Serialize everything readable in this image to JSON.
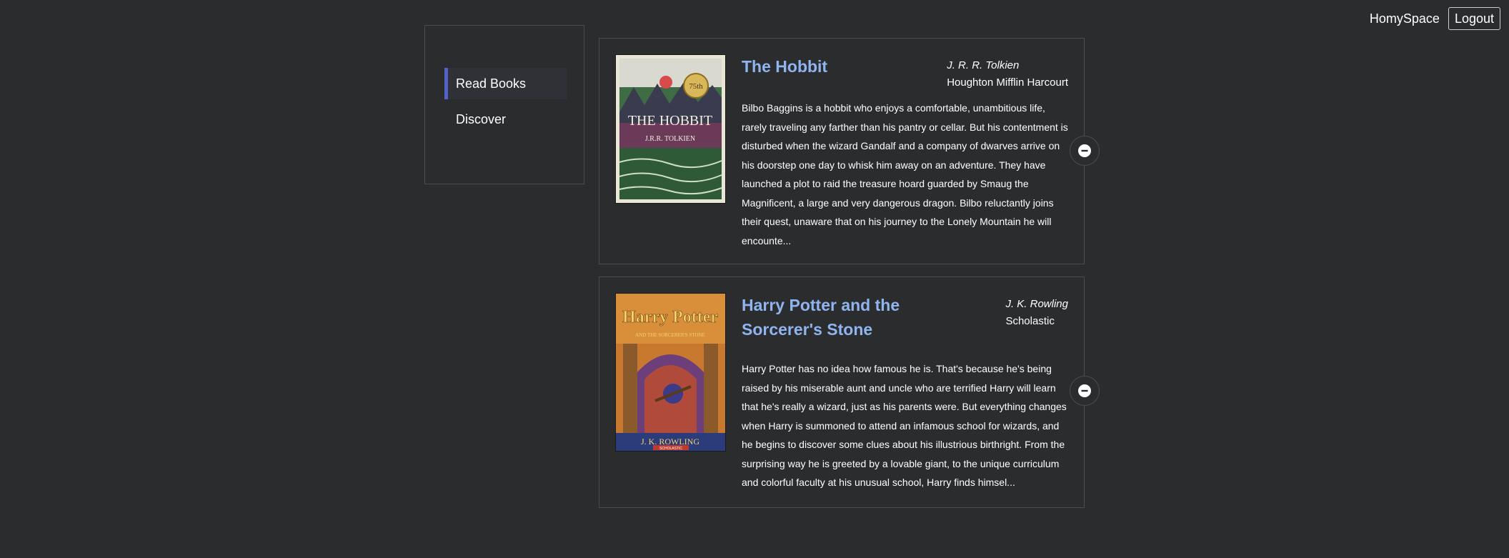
{
  "header": {
    "brand": "HomySpace",
    "logout_label": "Logout"
  },
  "sidebar": {
    "items": [
      {
        "label": "Read Books",
        "active": true
      },
      {
        "label": "Discover",
        "active": false
      }
    ]
  },
  "books": [
    {
      "title": "The Hobbit",
      "author": "J. R. R. Tolkien",
      "publisher": "Houghton Mifflin Harcourt",
      "description": "Bilbo Baggins is a hobbit who enjoys a comfortable, unambitious life, rarely traveling any farther than his pantry or cellar. But his contentment is disturbed when the wizard Gandalf and a company of dwarves arrive on his doorstep one day to whisk him away on an adventure. They have launched a plot to raid the treasure hoard guarded by Smaug the Magnificent, a large and very dangerous dragon. Bilbo reluctantly joins their quest, unaware that on his journey to the Lonely Mountain he will encounte...",
      "cover_text": {
        "title": "THE HOBBIT",
        "badge": "75th",
        "footer": "J.R.R. TOLKIEN"
      }
    },
    {
      "title": "Harry Potter and the Sorcerer's Stone",
      "author": "J. K. Rowling",
      "publisher": "Scholastic",
      "description": "Harry Potter has no idea how famous he is. That's because he's being raised by his miserable aunt and uncle who are terrified Harry will learn that he's really a wizard, just as his parents were. But everything changes when Harry is summoned to attend an infamous school for wizards, and he begins to discover some clues about his illustrious birthright. From the surprising way he is greeted by a lovable giant, to the unique curriculum and colorful faculty at his unusual school, Harry finds himsel...",
      "cover_text": {
        "title": "Harry Potter",
        "subtitle": "AND THE SORCERER'S STONE",
        "author": "J. K. ROWLING",
        "imprint": "SCHOLASTIC"
      }
    }
  ],
  "icons": {
    "remove": "minus-circle-icon"
  },
  "colors": {
    "background": "#2b2c2e",
    "title_link": "#8fb4f0",
    "active_accent": "#5262c7",
    "border": "#4b4c4f"
  }
}
